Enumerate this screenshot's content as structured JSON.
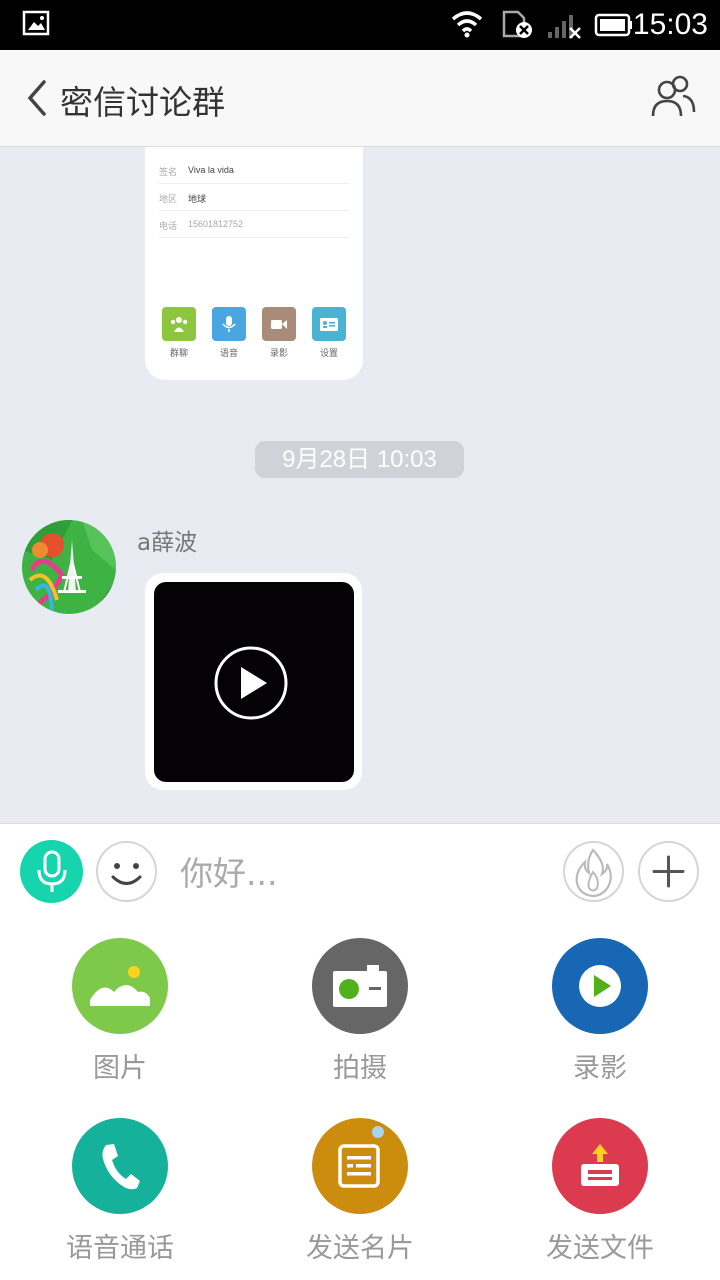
{
  "status_bar": {
    "time": "15:03"
  },
  "header": {
    "title": "密信讨论群"
  },
  "profile_card": {
    "rows": [
      {
        "key": "签名",
        "value": "Viva la vida"
      },
      {
        "key": "地区",
        "value": "地球"
      },
      {
        "key": "电话",
        "value": "15601812752"
      }
    ],
    "apps": [
      {
        "label": "群聊",
        "color": "#8cc63f"
      },
      {
        "label": "语音",
        "color": "#4aa6e0"
      },
      {
        "label": "录影",
        "color": "#a98b7a"
      },
      {
        "label": "设置",
        "color": "#4ab3d4"
      }
    ]
  },
  "chat": {
    "timestamp": "9月28日 10:03",
    "message": {
      "sender": "a薛波",
      "type": "video"
    }
  },
  "input": {
    "placeholder": "你好..."
  },
  "panel": {
    "items": [
      {
        "label": "图片",
        "color": "#7ec94a",
        "icon": "image-icon"
      },
      {
        "label": "拍摄",
        "color": "#666666",
        "icon": "camera-icon"
      },
      {
        "label": "录影",
        "color": "#1767b4",
        "icon": "video-record-icon"
      },
      {
        "label": "语音通话",
        "color": "#15b19a",
        "icon": "phone-icon"
      },
      {
        "label": "发送名片",
        "color": "#cc8d0f",
        "icon": "business-card-icon"
      },
      {
        "label": "发送文件",
        "color": "#db3a4f",
        "icon": "file-upload-icon"
      }
    ]
  },
  "colors": {
    "accent": "#16d4ad",
    "chat_bg": "#e8ebf1"
  }
}
